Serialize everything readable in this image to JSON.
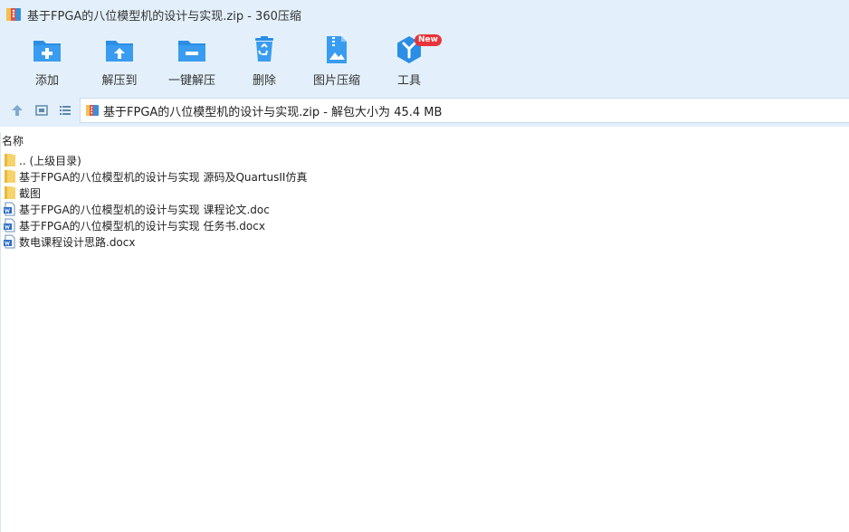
{
  "window": {
    "title": "基于FPGA的八位模型机的设计与实现.zip - 360压缩"
  },
  "toolbar": {
    "items": [
      {
        "label": "添加",
        "icon": "add-folder-icon"
      },
      {
        "label": "解压到",
        "icon": "extract-to-icon"
      },
      {
        "label": "一键解压",
        "icon": "one-click-extract-icon"
      },
      {
        "label": "删除",
        "icon": "recycle-bin-icon"
      },
      {
        "label": "图片压缩",
        "icon": "image-compress-icon"
      },
      {
        "label": "工具",
        "icon": "tools-icon",
        "badge": "New"
      }
    ]
  },
  "address": {
    "path": "基于FPGA的八位模型机的设计与实现.zip - 解包大小为 45.4 MB"
  },
  "columns": {
    "name": "名称"
  },
  "files": [
    {
      "name": ".. (上级目录)",
      "type": "folder"
    },
    {
      "name": "基于FPGA的八位模型机的设计与实现 源码及QuartusII仿真",
      "type": "folder"
    },
    {
      "name": "截图",
      "type": "folder"
    },
    {
      "name": "基于FPGA的八位模型机的设计与实现 课程论文.doc",
      "type": "word"
    },
    {
      "name": "基于FPGA的八位模型机的设计与实现 任务书.docx",
      "type": "word"
    },
    {
      "name": "数电课程设计思路.docx",
      "type": "word"
    }
  ],
  "colors": {
    "toolbar_bg": "#e3f0fb",
    "icon_blue": "#2a8ee4",
    "badge_red": "#e8343a",
    "folder_yellow": "#f7d36b"
  }
}
